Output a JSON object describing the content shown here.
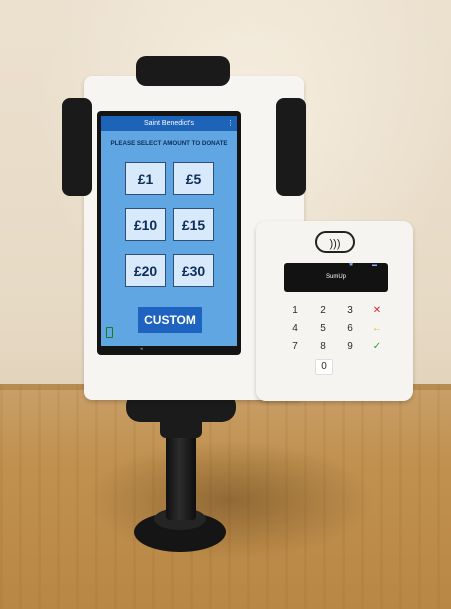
{
  "kiosk": {
    "title": "Saint Benedict's",
    "prompt": "PLEASE SELECT AMOUNT TO DONATE",
    "amounts": [
      "£1",
      "£5",
      "£10",
      "£15",
      "£20",
      "£30"
    ],
    "custom_label": "CUSTOM"
  },
  "card_reader": {
    "brand_text": "SumUp",
    "contactless_symbol": ")))",
    "keys": [
      "1",
      "2",
      "3",
      "4",
      "5",
      "6",
      "7",
      "8",
      "9",
      "0"
    ],
    "cancel_symbol": "✕",
    "back_symbol": "←",
    "ok_symbol": "✓"
  },
  "colors": {
    "screen_bg": "#5fa6e2",
    "app_bar": "#1d63b8",
    "custom_button": "#1e63c0",
    "cancel_key": "#d62c2c",
    "back_key": "#e3b300",
    "ok_key": "#2fa331"
  }
}
